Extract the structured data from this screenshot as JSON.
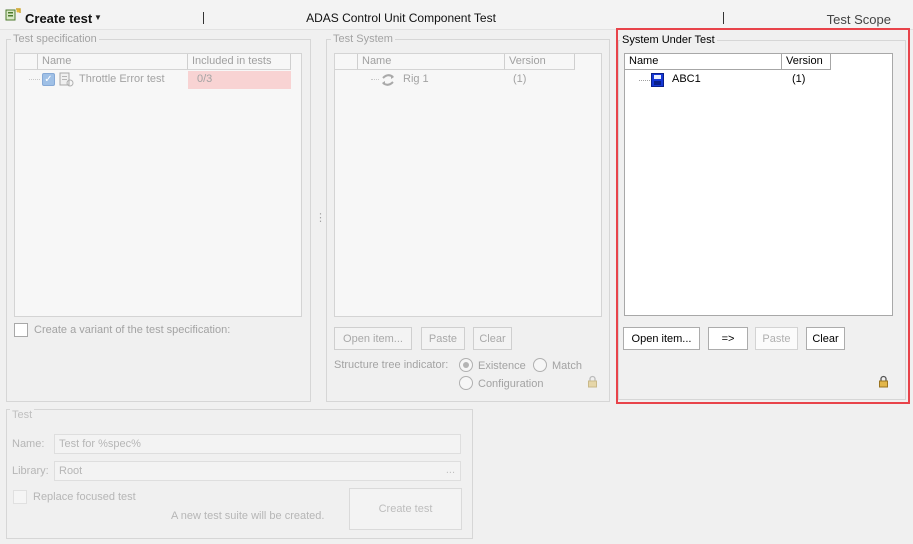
{
  "toolbar": {
    "create_test_label": "Create test",
    "title": "ADAS Control Unit Component Test",
    "test_scope_label": "Test Scope"
  },
  "test_specification": {
    "legend": "Test specification",
    "columns": [
      "Name",
      "Included in tests"
    ],
    "rows": [
      {
        "name": "Throttle Error test",
        "included": "0/3"
      }
    ],
    "variant_checkbox_label": "Create a variant of the test specification:"
  },
  "test_system": {
    "legend": "Test System",
    "columns": [
      "Name",
      "Version"
    ],
    "rows": [
      {
        "name": "Rig 1",
        "version": "(1)"
      }
    ],
    "buttons": {
      "open": "Open item...",
      "paste": "Paste",
      "clear": "Clear"
    },
    "structure_label": "Structure tree indicator:",
    "options": {
      "existence": "Existence",
      "match": "Match",
      "configuration": "Configuration"
    },
    "selected_option": "Existence"
  },
  "system_under_test": {
    "legend": "System Under Test",
    "columns": [
      "Name",
      "Version"
    ],
    "rows": [
      {
        "name": "ABC1",
        "version": "(1)"
      }
    ],
    "buttons": {
      "open": "Open item...",
      "assign": "=>",
      "paste": "Paste",
      "clear": "Clear"
    }
  },
  "test": {
    "legend": "Test",
    "name_label": "Name:",
    "name_value": "Test for %spec%",
    "library_label": "Library:",
    "library_value": "Root",
    "library_browse": "...",
    "replace_label": "Replace focused test",
    "info_text": "A new test suite will be created.",
    "create_button": "Create test"
  },
  "splitter": {
    "grip": "⋮"
  },
  "colors": {
    "highlight": "#e8434a",
    "error_cell": "#f8d3d3"
  }
}
